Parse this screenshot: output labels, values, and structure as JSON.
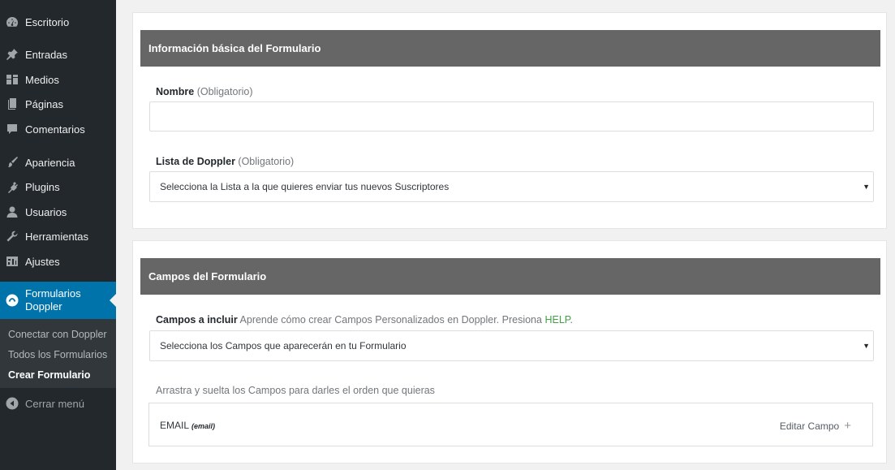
{
  "sidebar": {
    "items": [
      {
        "label": "Escritorio",
        "icon": "dashboard-icon"
      },
      {
        "label": "Entradas",
        "icon": "pin-icon"
      },
      {
        "label": "Medios",
        "icon": "media-icon"
      },
      {
        "label": "Páginas",
        "icon": "pages-icon"
      },
      {
        "label": "Comentarios",
        "icon": "comments-icon"
      },
      {
        "label": "Apariencia",
        "icon": "appearance-icon"
      },
      {
        "label": "Plugins",
        "icon": "plugins-icon"
      },
      {
        "label": "Usuarios",
        "icon": "users-icon"
      },
      {
        "label": "Herramientas",
        "icon": "tools-icon"
      },
      {
        "label": "Ajustes",
        "icon": "settings-icon"
      }
    ],
    "active": {
      "label_line1": "Formularios",
      "label_line2": "Doppler",
      "icon": "doppler-icon"
    },
    "submenu": [
      {
        "label": "Conectar con Doppler"
      },
      {
        "label": "Todos los Formularios"
      },
      {
        "label": "Crear Formulario",
        "current": true
      }
    ],
    "collapse_label": "Cerrar menú"
  },
  "panel_basic": {
    "heading": "Información básica del Formulario",
    "name_label": "Nombre",
    "name_required": "(Obligatorio)",
    "name_value": "",
    "list_label": "Lista de Doppler",
    "list_required": "(Obligatorio)",
    "list_select": "Selecciona la Lista a la que quieres enviar tus nuevos Suscriptores"
  },
  "panel_fields": {
    "heading": "Campos del Formulario",
    "include_label": "Campos a incluir",
    "include_hint": "Aprende cómo crear Campos Personalizados en Doppler. Presiona",
    "help_link": "HELP",
    "help_period": ".",
    "fields_select": "Selecciona los Campos que aparecerán en tu Formulario",
    "drag_hint": "Arrastra y suelta los Campos para darles el orden que quieras",
    "field": {
      "name": "EMAIL",
      "type": "(email)",
      "edit_label": "Editar Campo",
      "plus": "+"
    }
  },
  "colors": {
    "sidebar_bg": "#23282d",
    "active_bg": "#0073aa",
    "panel_head_bg": "#666666",
    "help_link": "#43a047"
  }
}
